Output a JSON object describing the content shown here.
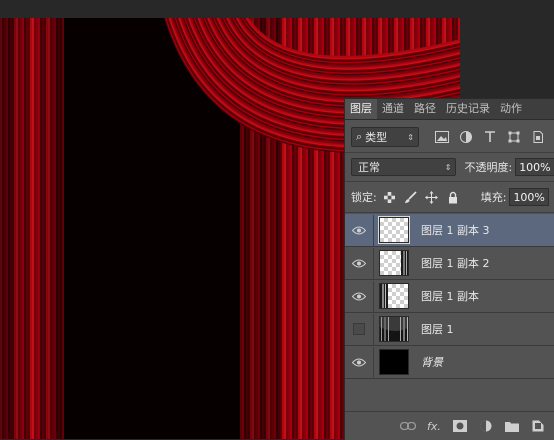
{
  "panel": {
    "tabs": [
      "图层",
      "通道",
      "路径",
      "历史记录",
      "动作"
    ],
    "filter": {
      "label": "类型",
      "search_glyph": "⌕",
      "arrow": "⇕"
    },
    "blend_mode": "正常",
    "opacity_label": "不透明度:",
    "opacity_value": "100%",
    "lock_label": "锁定:",
    "fill_label": "填充:",
    "fill_value": "100%",
    "fx_label": "fx."
  },
  "layers": [
    {
      "name": "图层 1 副本 3",
      "visible": true,
      "selected": true,
      "thumb": "transparent-small"
    },
    {
      "name": "图层 1 副本 2",
      "visible": true,
      "selected": false,
      "thumb": "transparent-right"
    },
    {
      "name": "图层 1 副本",
      "visible": true,
      "selected": false,
      "thumb": "transparent-left"
    },
    {
      "name": "图层 1",
      "visible": false,
      "selected": false,
      "thumb": "curtain"
    },
    {
      "name": "背景",
      "visible": true,
      "selected": false,
      "thumb": "black"
    }
  ],
  "colors": {
    "curtain_red": "#a0000e",
    "canvas_black": "#060000",
    "panel_bg": "#535353",
    "selected_row": "#5c687e"
  }
}
